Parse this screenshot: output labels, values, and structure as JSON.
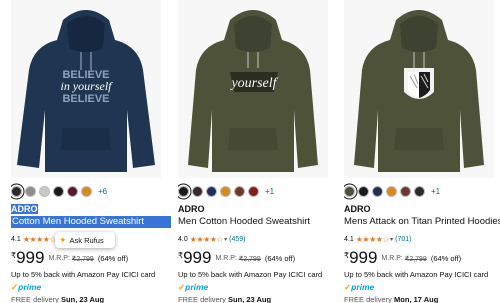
{
  "products": [
    {
      "brand": "ADRO",
      "title": "Cotton Men Hooded Sweatshirt",
      "rating": "4.1",
      "stars": "★★★★☆",
      "review_count": "",
      "currency": "₹",
      "price": "999",
      "mrp_label": "M.R.P:",
      "mrp": "₹2,799",
      "discount": "(64% off)",
      "cashback": "Up to 5% back with Amazon Pay ICICI card",
      "prime": "prime",
      "delivery_label": "FREE delivery",
      "delivery_date": "Sun, 23 Aug",
      "more_colors": "+6",
      "swatch_colors": [
        "#2b2b2b",
        "#8e8e8e",
        "#c8c8c8",
        "#1a1a1a",
        "#5a1a2a",
        "#d98a1e"
      ],
      "garment_color": "#1f3552",
      "print_text_1": "BELIEVE",
      "print_text_2": "in yourself",
      "print_text_3": "BELIEVE"
    },
    {
      "brand": "ADRO",
      "title": "Men Cotton Hooded Sweatshirt",
      "rating": "4.0",
      "stars": "★★★★☆",
      "review_count": "(459)",
      "currency": "₹",
      "price": "999",
      "mrp_label": "M.R.P:",
      "mrp": "₹2,799",
      "discount": "(64% off)",
      "cashback": "Up to 5% back with Amazon Pay ICICI card",
      "prime": "prime",
      "delivery_label": "FREE delivery",
      "delivery_date": "Sun, 23 Aug",
      "more_colors": "+1",
      "swatch_colors": [
        "#1a1a1a",
        "#3a2a2a",
        "#1f2f55",
        "#d98a1e",
        "#6b3a2a",
        "#8b1a1a"
      ],
      "garment_color": "#4e5239",
      "print_text_1": "yourself"
    },
    {
      "brand": "ADRO",
      "title": "Mens Attack on Titan Printed Hoodies",
      "rating": "4.1",
      "stars": "★★★★☆",
      "review_count": "(701)",
      "currency": "₹",
      "price": "999",
      "mrp_label": "M.R.P:",
      "mrp": "₹2,799",
      "discount": "(64% off)",
      "cashback": "Up to 5% back with Amazon Pay ICICI card",
      "prime": "prime",
      "delivery_label": "FREE delivery",
      "delivery_date": "Mon, 17 Aug",
      "more_colors": "+1",
      "swatch_colors": [
        "#4e5239",
        "#1a1a1a",
        "#1f2f55",
        "#d98a1e",
        "#6b3a2a",
        "#2b2b2b"
      ],
      "garment_color": "#4e5239"
    }
  ],
  "rufus": {
    "label": "Ask Rufus"
  },
  "colors": {
    "highlight": "#3874d8",
    "link": "#007185",
    "star": "#de7921",
    "prime": "#00a8e1"
  }
}
